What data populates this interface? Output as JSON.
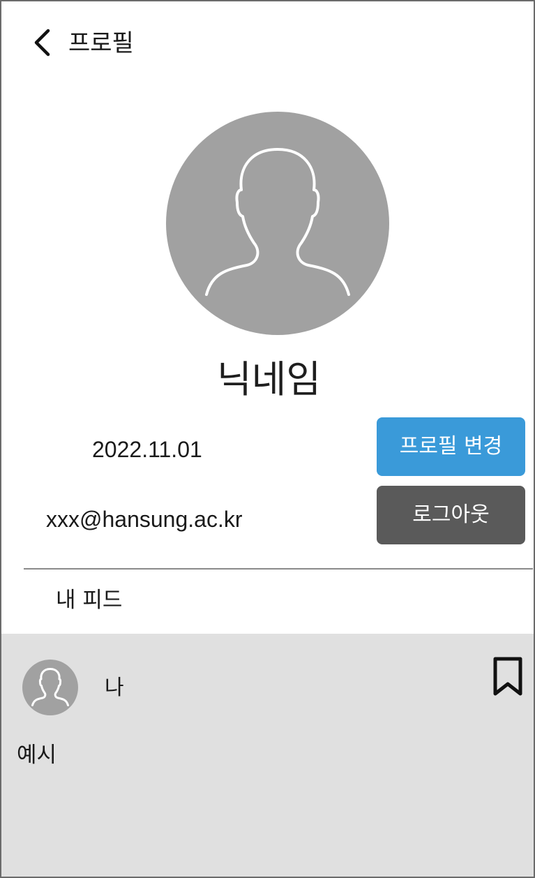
{
  "header": {
    "back_icon": "chevron-left-icon",
    "title": "프로필"
  },
  "profile": {
    "avatar_icon": "user-silhouette-icon",
    "nickname": "닉네임",
    "join_date": "2022.11.01",
    "email": "xxx@hansung.ac.kr",
    "edit_button_label": "프로필 변경",
    "logout_button_label": "로그아웃"
  },
  "feed": {
    "section_title": "내 피드",
    "posts": [
      {
        "author": "나",
        "content": "예시",
        "bookmark_icon": "bookmark-icon"
      }
    ]
  },
  "colors": {
    "edit_button": "#3a9ad9",
    "logout_button": "#5a5a5a",
    "avatar_bg": "#a1a1a1",
    "feed_card_bg": "#e0e0e0"
  }
}
